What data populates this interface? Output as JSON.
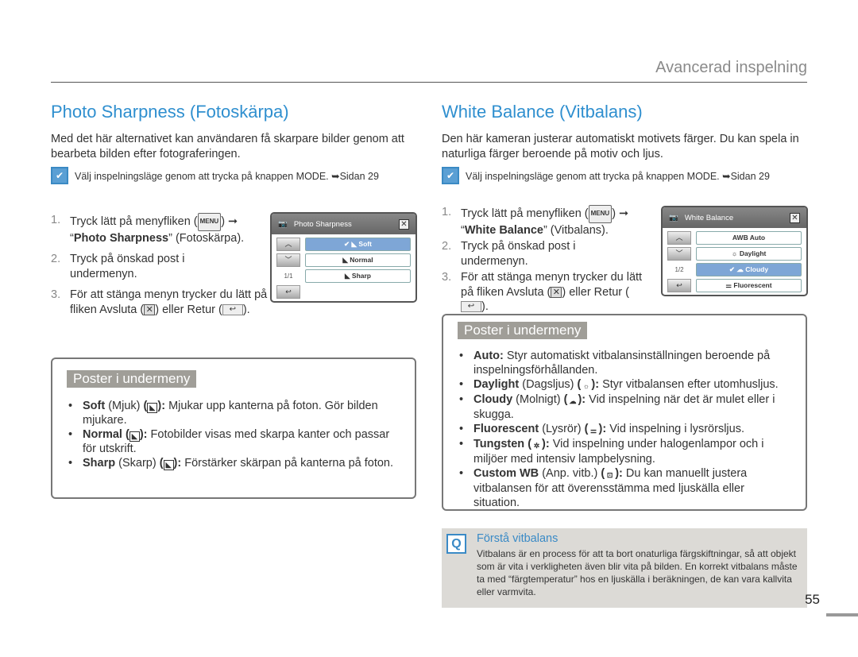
{
  "header": "Avancerad inspelning",
  "page_number": "55",
  "left": {
    "title": "Photo Sharpness (Fotoskärpa)",
    "intro": "Med det här alternativet kan användaren få skarpare bilder genom att bearbeta bilden efter fotograferingen.",
    "note": "Välj inspelningsläge genom att trycka på knappen MODE. ➥Sidan 29",
    "steps": [
      {
        "n": "1.",
        "a": "Tryck lätt på menyfliken (",
        "key": "MENU",
        "b": ") ➞ “",
        "bold": "Photo Sharpness",
        "c": "” (Fotoskärpa)."
      },
      {
        "n": "2.",
        "text": "Tryck på önskad post i undermenyn."
      },
      {
        "n": "3.",
        "a": "För att stänga menyn trycker du lätt på fliken Avsluta (",
        "b": ") eller Retur (",
        "c": ")."
      }
    ],
    "camera": {
      "title": "Photo Sharpness",
      "page": "1/1",
      "options": [
        "Soft",
        "Normal",
        "Sharp"
      ],
      "selected": "Soft"
    },
    "submenu_label": "Poster i undermeny",
    "items": [
      {
        "term": "Soft",
        "paren": "(Mjuk)",
        "desc": "Mjukar upp kanterna på foton. Gör bilden mjukare."
      },
      {
        "term": "Normal",
        "paren": "",
        "desc": "Fotobilder visas med skarpa kanter och passar för utskrift."
      },
      {
        "term": "Sharp",
        "paren": "(Skarp)",
        "desc": "Förstärker skärpan på kanterna på foton."
      }
    ]
  },
  "right": {
    "title": "White Balance (Vitbalans)",
    "intro": "Den här kameran justerar automatiskt motivets färger. Du kan spela in naturliga färger beroende på motiv och ljus.",
    "note": "Välj inspelningsläge genom att trycka på knappen MODE. ➥Sidan 29",
    "steps": [
      {
        "n": "1.",
        "a": "Tryck lätt på menyfliken (",
        "key": "MENU",
        "b": ") ➞ “",
        "bold": "White Balance",
        "c": "” (Vitbalans)."
      },
      {
        "n": "2.",
        "text": "Tryck på önskad post i undermenyn."
      },
      {
        "n": "3.",
        "a": "För att stänga menyn trycker du lätt på fliken Avsluta (",
        "b": ") eller Retur (",
        "c": ")."
      }
    ],
    "camera": {
      "title": "White Balance",
      "page": "1/2",
      "options": [
        "Auto",
        "Daylight",
        "Cloudy",
        "Fluorescent"
      ],
      "selected": "Cloudy"
    },
    "submenu_label": "Poster i undermeny",
    "items": [
      {
        "term": "Auto:",
        "paren": "",
        "icon": "",
        "desc": "Styr automatiskt vitbalansinställningen beroende på inspelningsförhållanden."
      },
      {
        "term": "Daylight",
        "paren": "(Dagsljus)",
        "icon": "☼",
        "desc": "Styr vitbalansen efter utomhusljus."
      },
      {
        "term": "Cloudy",
        "paren": "(Molnigt)",
        "icon": "☁",
        "desc": "Vid inspelning när det är mulet eller i skugga."
      },
      {
        "term": "Fluorescent",
        "paren": "(Lysrör)",
        "icon": "⚌",
        "desc": "Vid inspelning i lysrörsljus."
      },
      {
        "term": "Tungsten",
        "paren": "",
        "icon": "✲",
        "desc": "Vid inspelning under halogenlampor och i miljöer med intensiv lampbelysning."
      },
      {
        "term": "Custom WB",
        "paren": "(Anp. vitb.)",
        "icon": "⊡",
        "desc": "Du kan manuellt justera vitbalansen för att överensstämma med ljuskälla eller situation."
      }
    ]
  },
  "tip": {
    "title": "Förstå vitbalans",
    "body": "Vitbalans är en process för att ta bort onaturliga färgskiftningar, så att objekt som är vita i verkligheten även blir vita på bilden. En korrekt vitbalans måste ta med “färgtemperatur” hos en ljuskälla i beräkningen, de kan vara kallvita eller varmvita."
  }
}
